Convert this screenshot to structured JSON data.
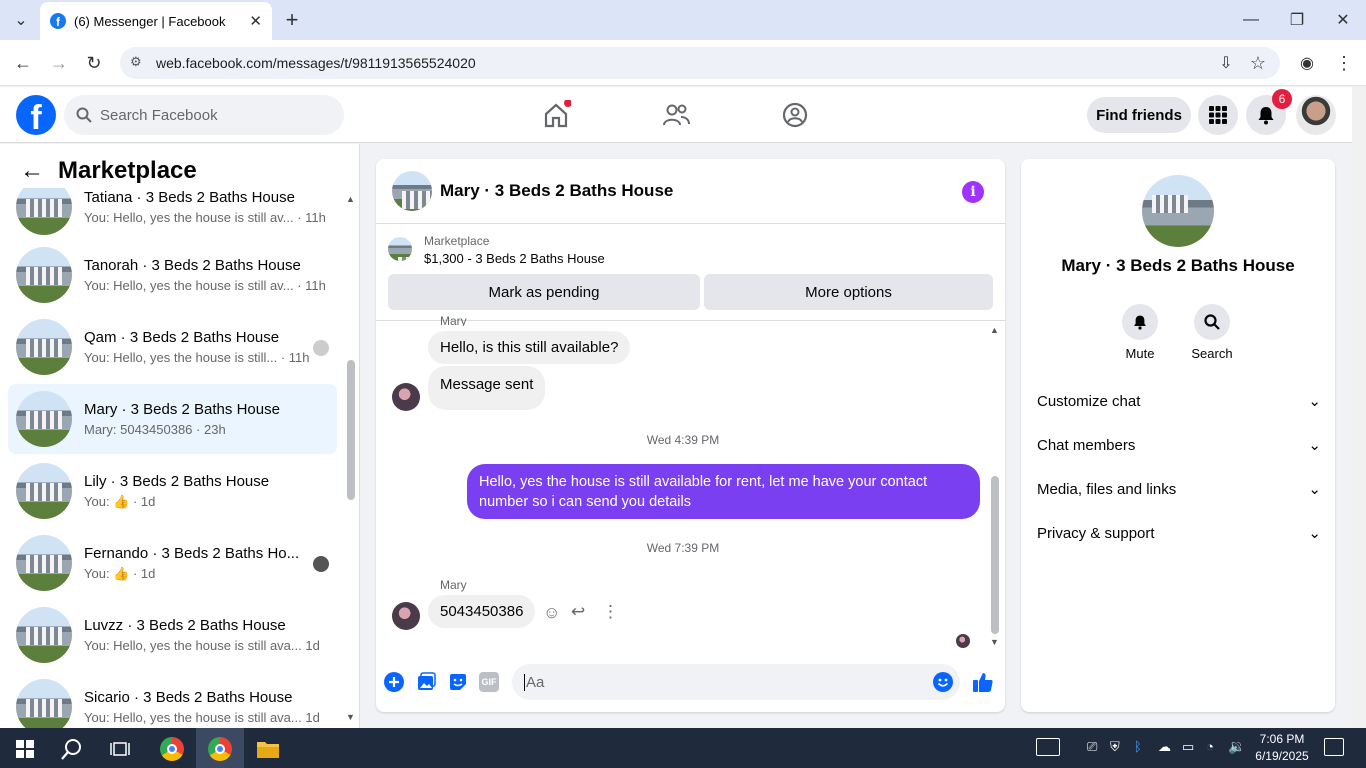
{
  "browser": {
    "tab_title": "(6) Messenger | Facebook",
    "url": "web.facebook.com/messages/t/9811913565524020"
  },
  "header": {
    "search_placeholder": "Search Facebook",
    "find_friends": "Find friends",
    "notification_count": "6"
  },
  "sidebar": {
    "title": "Marketplace",
    "conversations": [
      {
        "name": "Tatiana · 3 Beds 2 Baths House",
        "preview": "You: Hello, yes the house is still av...",
        "time": "· 11h"
      },
      {
        "name": "Tanorah · 3 Beds 2 Baths House",
        "preview": "You: Hello, yes the house is still av...",
        "time": "· 11h"
      },
      {
        "name": "Qam · 3 Beds 2 Baths House",
        "preview": "You: Hello, yes the house is still...",
        "time": "· 11h"
      },
      {
        "name": "Mary · 3 Beds 2 Baths House",
        "preview": "Mary: 5043450386",
        "time": "· 23h"
      },
      {
        "name": "Lily · 3 Beds 2 Baths House",
        "preview": "You: 👍",
        "time": "· 1d"
      },
      {
        "name": "Fernando · 3 Beds 2 Baths Ho...",
        "preview": "You: 👍",
        "time": "· 1d"
      },
      {
        "name": "Luvzz · 3 Beds 2 Baths House",
        "preview": "You: Hello, yes the house is still ava...",
        "time": "1d"
      },
      {
        "name": "Sicario · 3 Beds 2 Baths House",
        "preview": "You: Hello, yes the house is still ava...",
        "time": "1d"
      }
    ]
  },
  "chat": {
    "title": "Mary · 3 Beds 2 Baths House",
    "marketplace_label": "Marketplace",
    "listing": "$1,300 - 3 Beds 2 Baths House",
    "mark_pending": "Mark as pending",
    "more_options": "More options",
    "sender_top": "Mary",
    "msg1": "Hello, is this still available?",
    "msg2": "Message sent",
    "ts1": "Wed 4:39 PM",
    "msg_out": "Hello, yes the house is still available for rent, let me have your contact number so i can send you  details",
    "ts2": "Wed 7:39 PM",
    "sender": "Mary",
    "msg3": "5043450386",
    "composer_placeholder": "Aa",
    "gif_label": "GIF"
  },
  "rpanel": {
    "name": "Mary · 3 Beds 2 Baths House",
    "mute": "Mute",
    "search": "Search",
    "rows": [
      "Customize chat",
      "Chat members",
      "Media, files and links",
      "Privacy & support"
    ]
  },
  "taskbar": {
    "time": "7:06 PM",
    "date": "6/19/2025"
  }
}
